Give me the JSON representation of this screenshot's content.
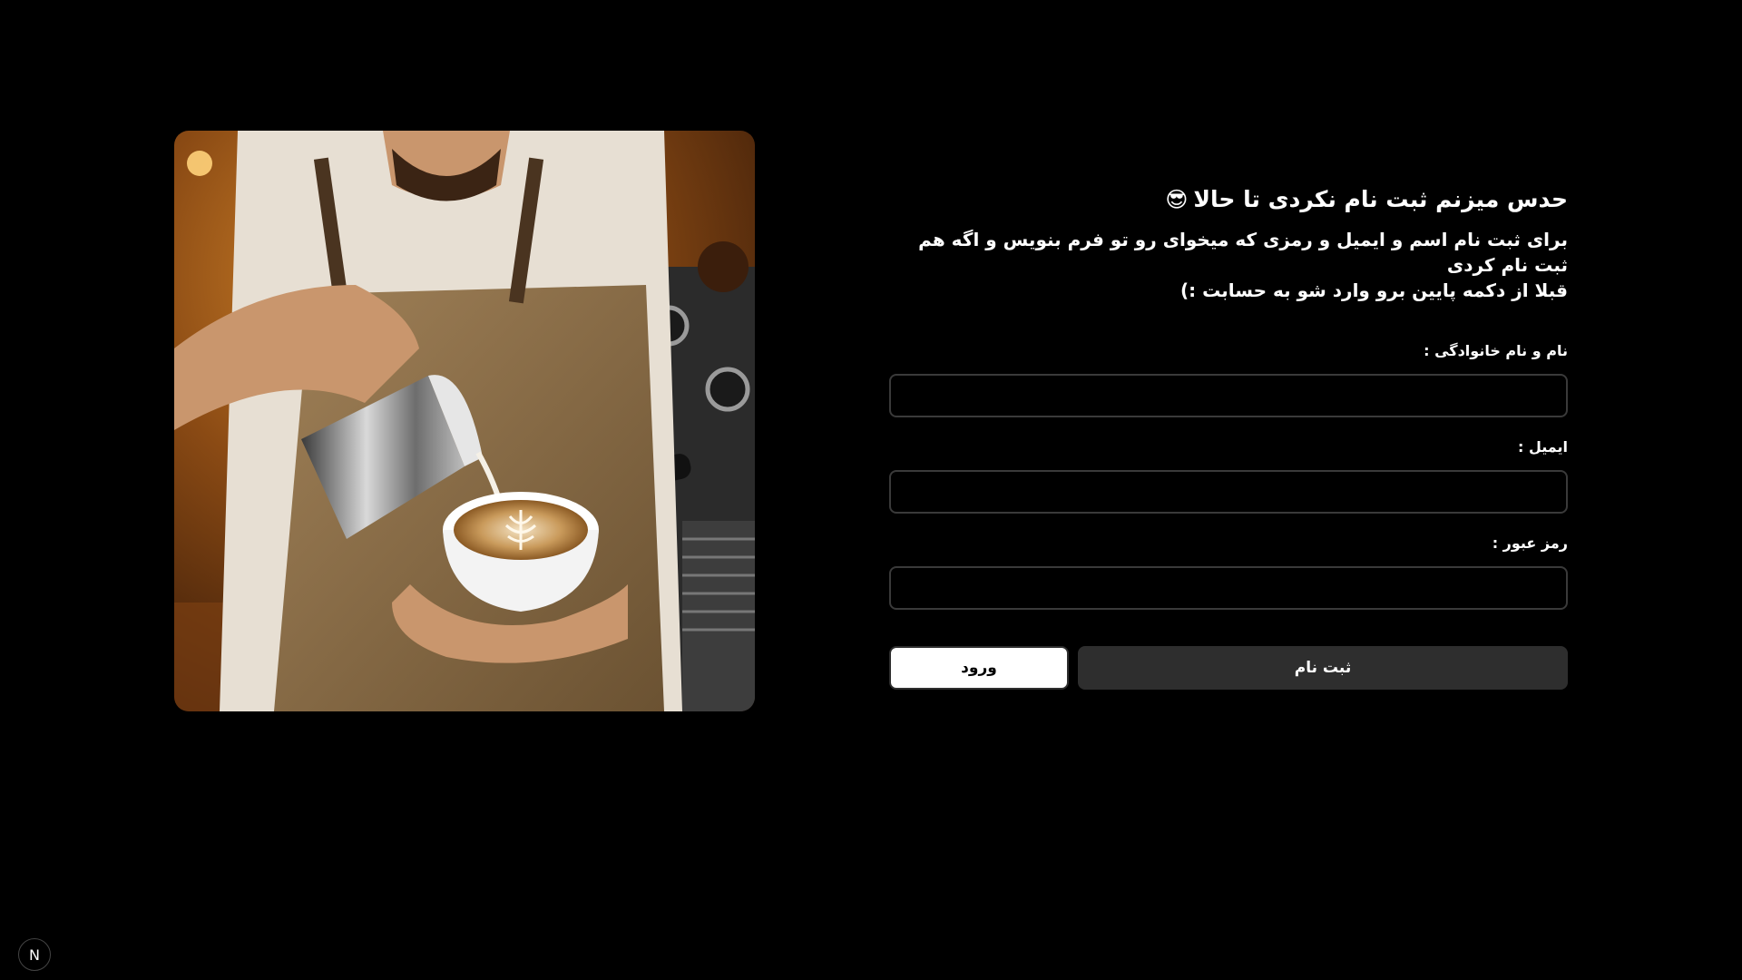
{
  "hero": {
    "alt": "barista pouring latte art"
  },
  "form": {
    "title": "حدس میزنم ثبت نام نکردی تا حالا",
    "title_emoji": "😎",
    "description_line1": "برای ثبت نام اسم و ایمیل و رمزی که میخوای رو تو فرم بنویس و اگه هم ثبت نام کردی",
    "description_line2": "قبلا از دکمه پایین برو وارد شو به حسابت :)",
    "fields": {
      "name": {
        "label": "نام و نام خانوادگی :",
        "value": "",
        "placeholder": ""
      },
      "email": {
        "label": "ایمیل :",
        "value": "",
        "placeholder": ""
      },
      "password": {
        "label": "رمز عبور :",
        "value": "",
        "placeholder": ""
      }
    },
    "buttons": {
      "register": "ثبت نام",
      "login": "ورود"
    }
  },
  "badge": {
    "icon": "nextjs-logo-icon",
    "glyph": "N"
  },
  "colors": {
    "background": "#000000",
    "text": "#ffffff",
    "register_button": "#2e2e2e",
    "login_button": "#ffffff",
    "field_border": "#3a3a3a"
  }
}
